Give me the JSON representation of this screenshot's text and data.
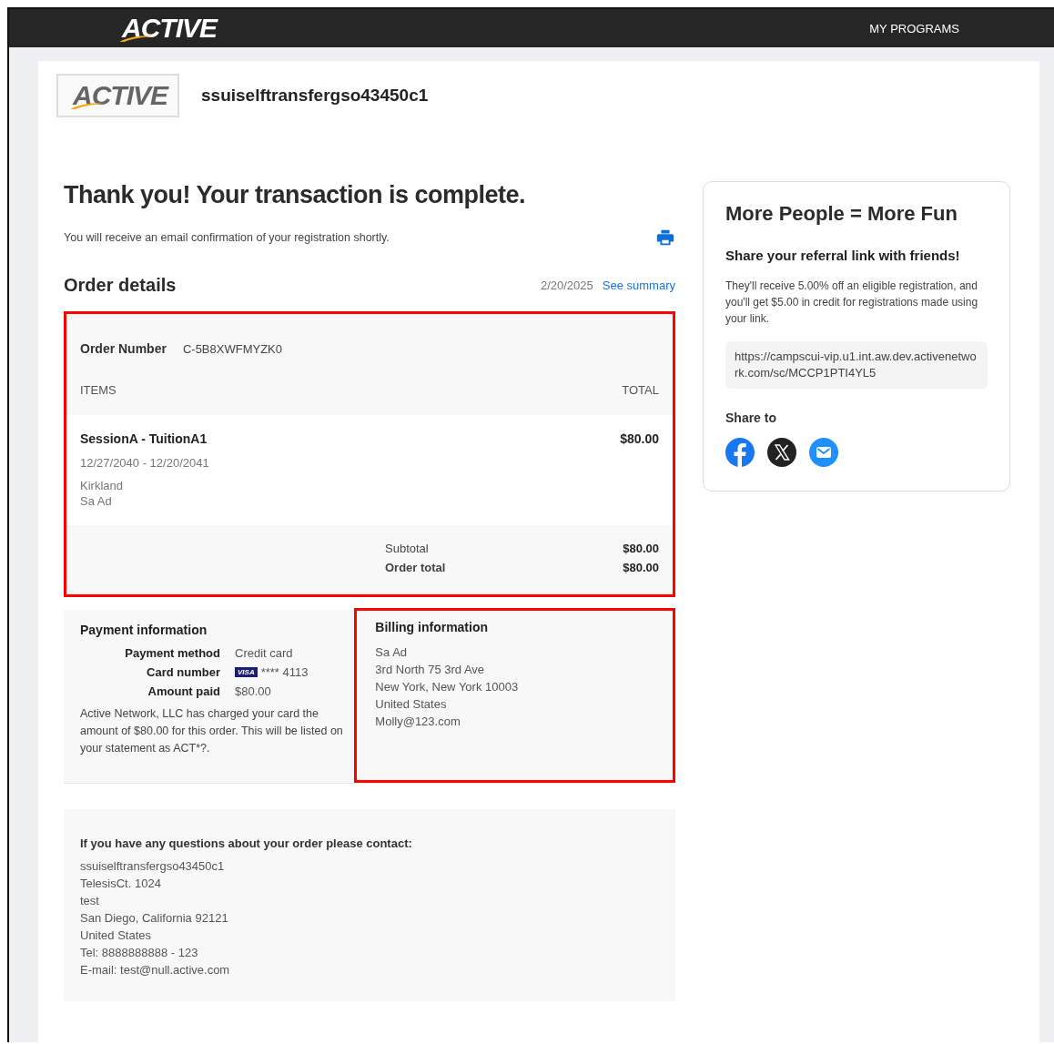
{
  "header": {
    "logo": "ACTIVE",
    "nav_link": "MY PROGRAMS"
  },
  "merchant": {
    "logo": "ACTIVE",
    "name": "ssuiselftransfergso43450c1"
  },
  "confirmation": {
    "title": "Thank you! Your transaction is complete.",
    "message": "You will receive an email confirmation of your registration shortly."
  },
  "order_details": {
    "title": "Order details",
    "date": "2/20/2025",
    "summary_link": "See summary",
    "highlighted": true,
    "order_number_label": "Order Number",
    "order_number": "C-5B8XWFMYZK0",
    "columns": [
      "ITEMS",
      "TOTAL"
    ],
    "items": [
      {
        "name": "SessionA - TuitionA1",
        "dates": "12/27/2040 - 12/20/2041",
        "location": "Kirkland",
        "participant": "Sa Ad",
        "total": "$80.00"
      }
    ],
    "totals": [
      {
        "kind": "subtotal",
        "label": "Subtotal",
        "value": "$80.00"
      },
      {
        "kind": "grand",
        "label": "Order total",
        "value": "$80.00"
      }
    ]
  },
  "payment": {
    "title": "Payment information",
    "rows": [
      {
        "label": "Payment method",
        "value": "Credit card"
      },
      {
        "label": "Card number",
        "card_brand": "VISA",
        "value": "**** 4113"
      },
      {
        "label": "Amount paid",
        "value": "$80.00"
      }
    ],
    "note": "Active Network, LLC has charged your card the amount of $80.00 for this order. This will be listed on your statement as ACT*?."
  },
  "billing": {
    "title": "Billing information",
    "highlighted": true,
    "lines": [
      "Sa Ad",
      "3rd North 75 3rd Ave",
      "New York, New York 10003",
      "United States",
      "Molly@123.com"
    ]
  },
  "contact": {
    "title": "If you have any questions about your order please contact:",
    "lines": [
      "ssuiselftransfergso43450c1",
      "TelesisCt. 1024",
      "test",
      "San Diego, California 92121",
      "United States",
      "Tel: 8888888888 - 123",
      "E-mail: test@null.active.com"
    ]
  },
  "referral": {
    "title": "More People = More Fun",
    "subtitle": "Share your referral link with friends!",
    "description": "They'll receive 5.00% off an eligible registration, and you'll get $5.00 in credit for registrations made using your link.",
    "link": "https://campscui-vip.u1.int.aw.dev.activenetwork.com/sc/MCCP1PTI4YL5",
    "share_label": "Share to",
    "share_targets": [
      {
        "kind": "facebook"
      },
      {
        "kind": "x"
      },
      {
        "kind": "email"
      }
    ]
  }
}
